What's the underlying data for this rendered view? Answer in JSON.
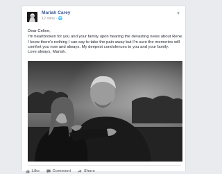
{
  "post": {
    "author": "Mariah Carey",
    "meta": "12 mins · 🌐",
    "options_icon": "chevron-down-icon",
    "message": {
      "greeting": "Dear Celine,",
      "body": "I'm heartbroken for you and your family upon hearing the devasting news about Rene. I know there's nothing I can say to take the pain away but I'm sure the memories will comfort you now and always. My deepest condolences to you and your family.",
      "signoff": "Love always, Mariah."
    }
  },
  "actions": {
    "like": "Like",
    "comment": "Comment",
    "share": "Share"
  },
  "colors": {
    "name_blue": "#365899",
    "action_gray": "#7f7f7f",
    "page_bg": "#e9ebee"
  }
}
